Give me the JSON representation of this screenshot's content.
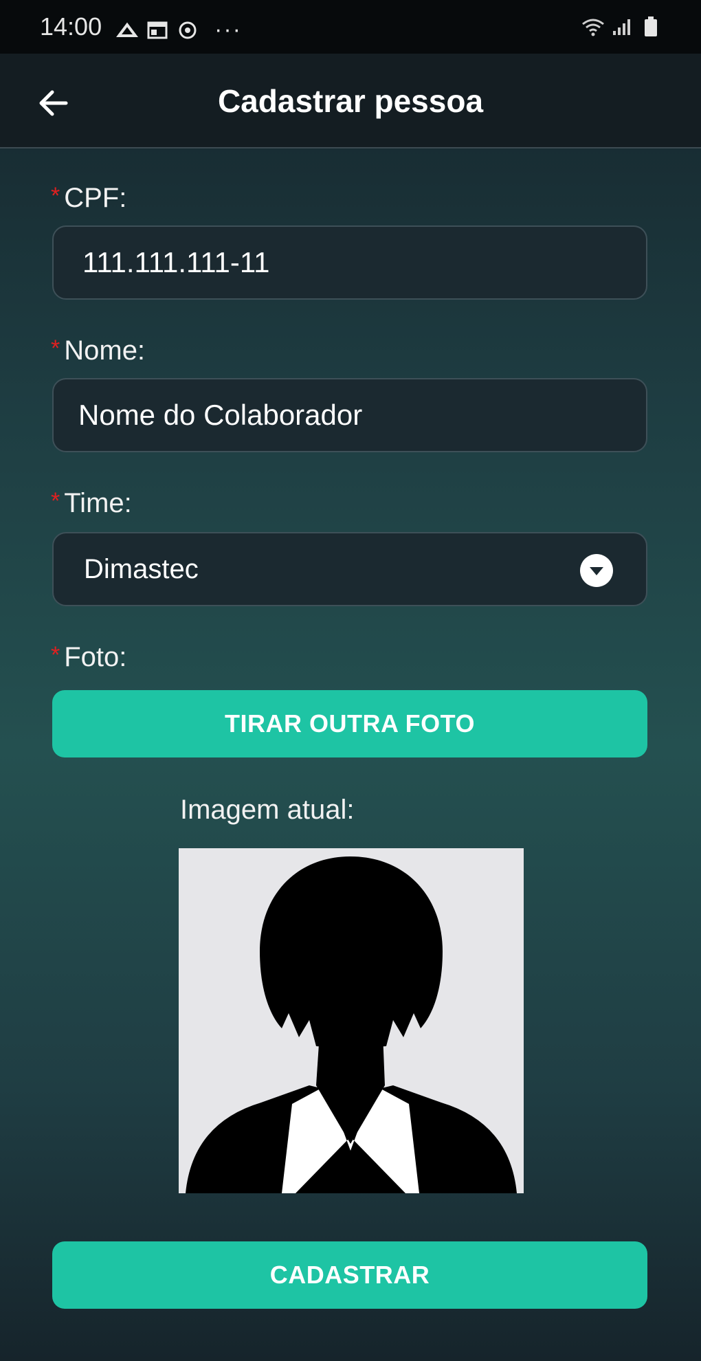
{
  "status_bar": {
    "time": "14:00",
    "left_icons": [
      "cloud-upload-icon",
      "calendar-icon",
      "sync-icon"
    ],
    "more": "···",
    "right_icons": [
      "wifi-icon",
      "signal-icon",
      "battery-icon"
    ]
  },
  "app_bar": {
    "title": "Cadastrar pessoa",
    "back_icon": "arrow-left-icon"
  },
  "form": {
    "required_mark": "*",
    "cpf": {
      "label": "CPF:",
      "value": "111.111.111-11"
    },
    "nome": {
      "label": "Nome:",
      "value": "Nome do Colaborador"
    },
    "time": {
      "label": "Time:",
      "value": "Dimastec",
      "icon": "chevron-down-circle-icon"
    },
    "foto": {
      "label": "Foto:",
      "button_label": "TIRAR OUTRA FOTO"
    },
    "current_image_label": "Imagem atual:",
    "submit_label": "CADASTRAR"
  },
  "colors": {
    "accent": "#1ec4a4",
    "required": "#e02020",
    "app_bar_bg": "#141d22",
    "input_bg": "#1b2930"
  }
}
